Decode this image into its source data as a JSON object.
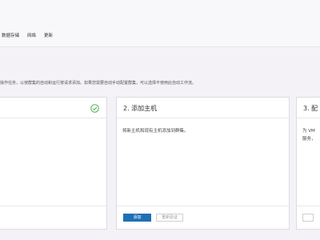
{
  "nav": {
    "items": [
      "数据存储",
      "网络",
      "更新"
    ]
  },
  "description": "操作任务，以使群集的自动和运行按请求添加。如果您需要自动手动配置群集，可以选择不使用此自动工作流。",
  "cards": [
    {
      "status_icon": "check-circle-icon"
    },
    {
      "title": "2. 添加主机",
      "body": "将新主机和现有主机添加到群集。",
      "primary_button": "添加",
      "secondary_button": "重新验证"
    },
    {
      "title": "3. 配",
      "body_line1": "为 VM",
      "body_line2": "服务，"
    }
  ],
  "colors": {
    "accent": "#1f6fb5",
    "success": "#4caf50",
    "page_background": "#f4f2f6"
  }
}
